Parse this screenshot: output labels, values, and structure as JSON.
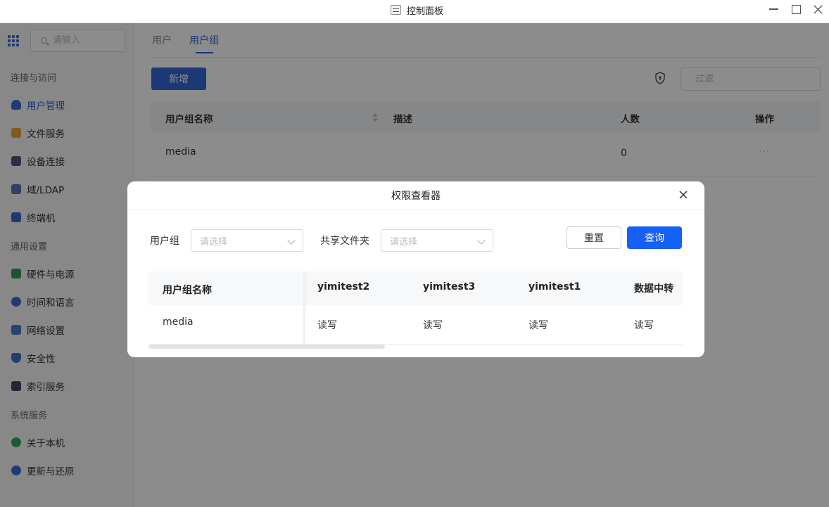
{
  "window": {
    "title": "控制面板"
  },
  "sidebar": {
    "search_placeholder": "请输入",
    "sections": [
      {
        "label": "连接与访问"
      },
      {
        "label": "通用设置"
      },
      {
        "label": "系统服务"
      }
    ],
    "items": [
      {
        "label": "用户管理",
        "icon": "user-icon",
        "color": "#3d6bd6",
        "active": true
      },
      {
        "label": "文件服务",
        "icon": "folder-icon",
        "color": "#e9a53a"
      },
      {
        "label": "设备连接",
        "icon": "device-icon",
        "color": "#4a5a78"
      },
      {
        "label": "域/LDAP",
        "icon": "domain-icon",
        "color": "#5876b5"
      },
      {
        "label": "终端机",
        "icon": "terminal-icon",
        "color": "#3e68c8"
      },
      {
        "label": "硬件与电源",
        "icon": "hardware-icon",
        "color": "#3a9a5c"
      },
      {
        "label": "时间和语言",
        "icon": "globe-icon",
        "color": "#3f6ccf"
      },
      {
        "label": "网络设置",
        "icon": "network-icon",
        "color": "#4a78d0"
      },
      {
        "label": "安全性",
        "icon": "shield-icon",
        "color": "#4470d0"
      },
      {
        "label": "索引服务",
        "icon": "index-icon",
        "color": "#3d4860"
      },
      {
        "label": "关于本机",
        "icon": "info-icon",
        "color": "#3aa35b"
      },
      {
        "label": "更新与还原",
        "icon": "update-icon",
        "color": "#3d6bd6"
      }
    ]
  },
  "main": {
    "tabs": [
      {
        "label": "用户"
      },
      {
        "label": "用户组",
        "active": true
      }
    ],
    "add_button": "新增",
    "filter_placeholder": "过滤",
    "table": {
      "headers": [
        "用户组名称",
        "描述",
        "人数",
        "操作"
      ],
      "rows": [
        {
          "name": "media",
          "description": "",
          "count": "0",
          "actions": "···"
        }
      ]
    }
  },
  "modal": {
    "title": "权限查看器",
    "group_label": "用户组",
    "group_placeholder": "请选择",
    "folder_label": "共享文件夹",
    "folder_placeholder": "请选择",
    "reset_button": "重置",
    "query_button": "查询",
    "table": {
      "headers": [
        "用户组名称",
        "yimitest2",
        "yimitest3",
        "yimitest1",
        "数据中转"
      ],
      "rows": [
        {
          "name": "media",
          "perms": [
            "读写",
            "读写",
            "读写",
            "读写"
          ]
        }
      ]
    }
  },
  "colors": {
    "accent": "#2b63d9",
    "primary_button": "#1560f5"
  }
}
